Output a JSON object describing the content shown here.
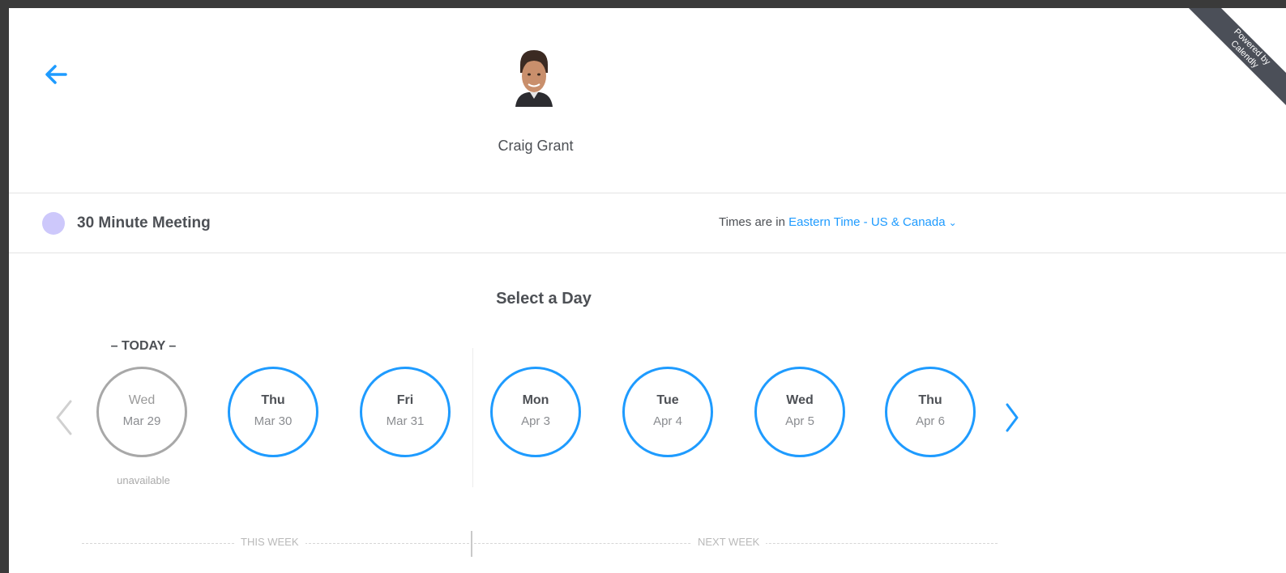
{
  "ribbon": {
    "text": "Powered by Calendly"
  },
  "host": {
    "name": "Craig Grant"
  },
  "event": {
    "name": "30 Minute Meeting",
    "color": "#cdc8fb"
  },
  "timezone": {
    "prefix": "Times are in ",
    "value": "Eastern Time - US & Canada"
  },
  "selector": {
    "title": "Select a Day",
    "today_label": "– TODAY –",
    "unavailable_label": "unavailable",
    "days": [
      {
        "dow": "Wed",
        "date": "Mar 29",
        "available": false
      },
      {
        "dow": "Thu",
        "date": "Mar 30",
        "available": true
      },
      {
        "dow": "Fri",
        "date": "Mar 31",
        "available": true
      },
      {
        "dow": "Mon",
        "date": "Apr 3",
        "available": true
      },
      {
        "dow": "Tue",
        "date": "Apr 4",
        "available": true
      },
      {
        "dow": "Wed",
        "date": "Apr 5",
        "available": true
      },
      {
        "dow": "Thu",
        "date": "Apr 6",
        "available": true
      }
    ],
    "this_week_label": "THIS WEEK",
    "next_week_label": "NEXT WEEK"
  },
  "colors": {
    "accent": "#1e9bff",
    "disabled": "#a8a8a8",
    "text": "#4d5055"
  }
}
